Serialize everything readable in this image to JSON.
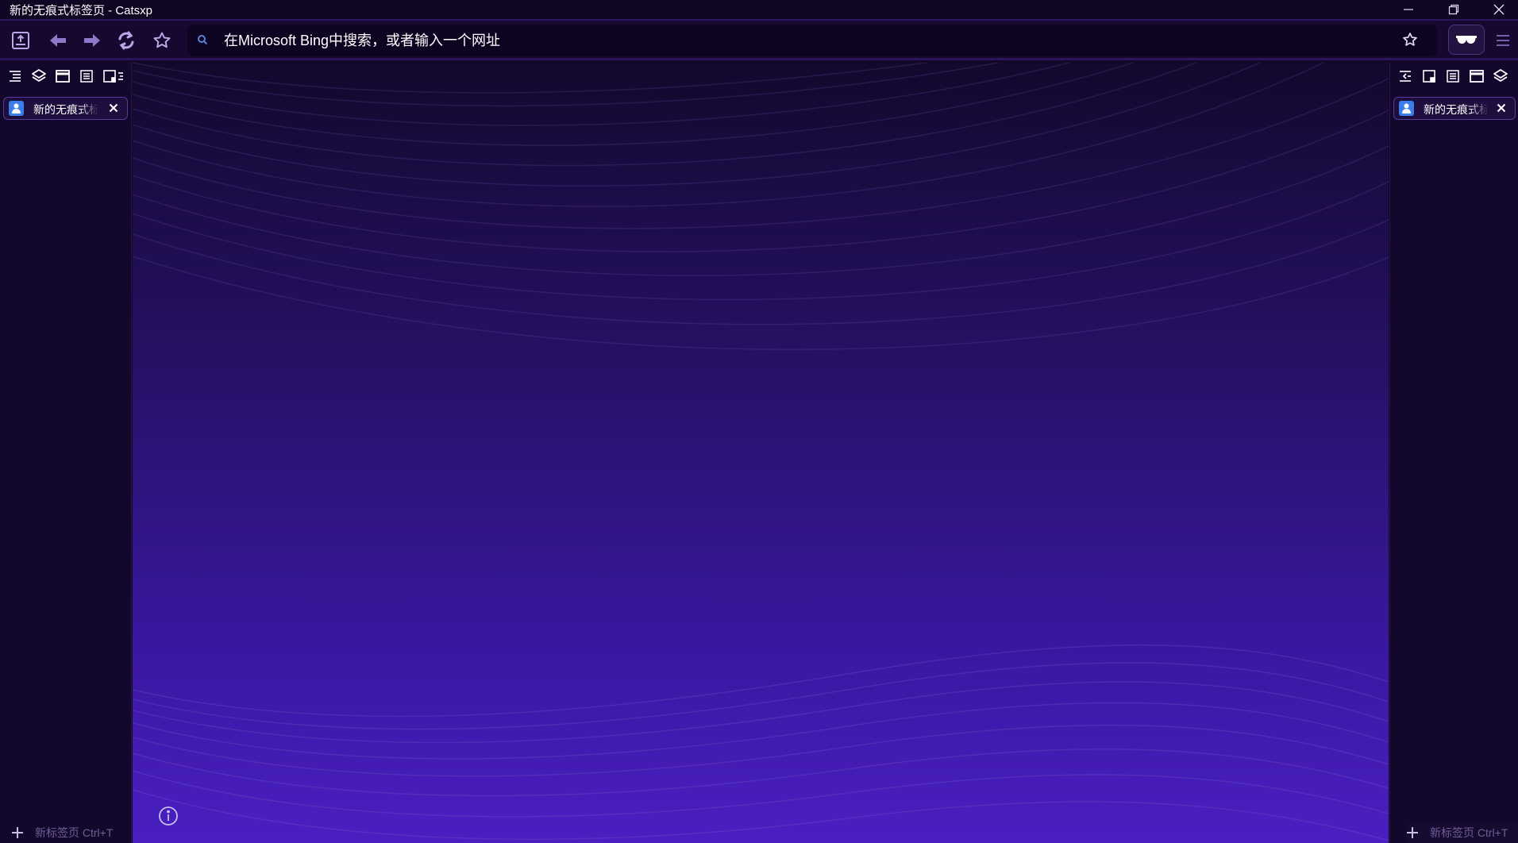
{
  "window": {
    "title": "新的无痕式标签页 - Catsxp"
  },
  "navbar": {
    "address_placeholder": "在Microsoft Bing中搜索，或者输入一个网址"
  },
  "left_panel": {
    "tabs": [
      {
        "title": "新的无痕式标签页"
      }
    ],
    "new_tab_label": "新标签页 Ctrl+T"
  },
  "right_panel": {
    "tabs": [
      {
        "title": "新的无痕式标签页"
      }
    ],
    "new_tab_label": "新标签页 Ctrl+T"
  },
  "colors": {
    "accent": "#553c98",
    "background_top": "#13082d",
    "background_bottom": "#4a1fc2",
    "favicon": "#3b7de9"
  }
}
